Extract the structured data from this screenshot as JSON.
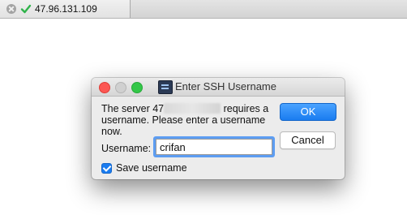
{
  "tab": {
    "title": "47.96.131.109",
    "close_icon": "close-icon",
    "status_icon": "checkmark-icon",
    "status_color": "#2fb34a"
  },
  "dialog": {
    "title": "Enter SSH Username",
    "icon": "terminal-icon",
    "message_prefix": "The server 47",
    "message_suffix": "requires a",
    "message_line2": "username.  Please enter a username",
    "message_line3": "now.",
    "ok_label": "OK",
    "cancel_label": "Cancel",
    "username_label": "Username:",
    "username_value": "crifan",
    "save_label": "Save username",
    "save_checked": true,
    "accent_color": "#1a7cf0"
  }
}
